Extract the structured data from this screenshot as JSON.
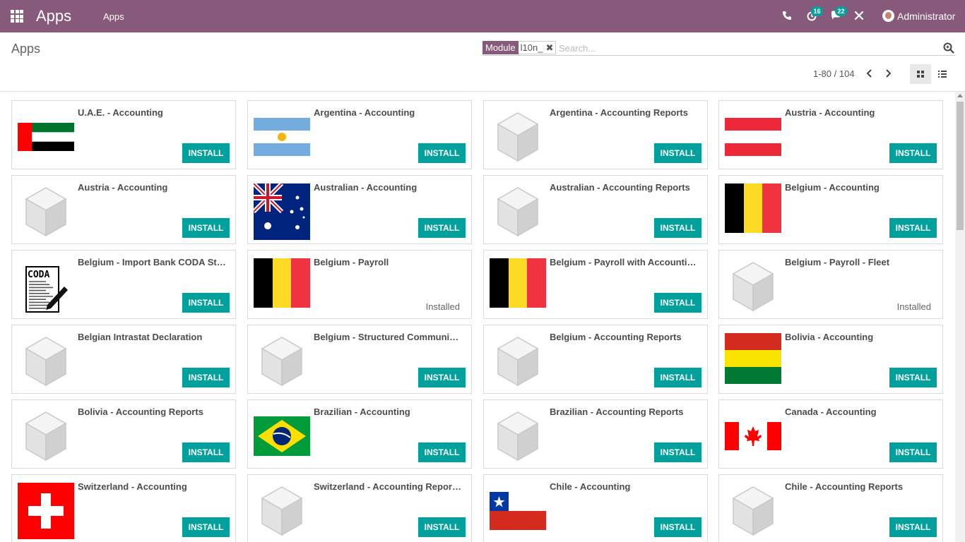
{
  "navbar": {
    "brand": "Apps",
    "menu_item": "Apps",
    "activity_count": "16",
    "messages_count": "22",
    "user_name": "Administrator",
    "bg_color": "#875a7b"
  },
  "control_panel": {
    "title": "Apps",
    "facet_category": "Module",
    "facet_value": "l10n_",
    "search_placeholder": "Search...",
    "pager_value": "1-80 / 104"
  },
  "colors": {
    "accent": "#00a09d",
    "brand": "#875a7b"
  },
  "apps": [
    {
      "name": "U.A.E. - Accounting",
      "icon": "flag-uae",
      "status": "INSTALL"
    },
    {
      "name": "Argentina - Accounting",
      "icon": "flag-argentina",
      "status": "INSTALL"
    },
    {
      "name": "Argentina - Accounting Reports",
      "icon": "default-module-cube",
      "status": "INSTALL"
    },
    {
      "name": "Austria - Accounting",
      "icon": "flag-austria",
      "status": "INSTALL"
    },
    {
      "name": "Austria - Accounting",
      "icon": "default-module-cube",
      "status": "INSTALL"
    },
    {
      "name": "Australian - Accounting",
      "icon": "flag-australia",
      "status": "INSTALL"
    },
    {
      "name": "Australian - Accounting Reports",
      "icon": "default-module-cube",
      "status": "INSTALL"
    },
    {
      "name": "Belgium - Accounting",
      "icon": "flag-belgium",
      "status": "INSTALL"
    },
    {
      "name": "Belgium - Import Bank CODA St…",
      "icon": "coda-document",
      "status": "INSTALL"
    },
    {
      "name": "Belgium - Payroll",
      "icon": "flag-belgium",
      "status": "Installed"
    },
    {
      "name": "Belgium - Payroll with Accounti…",
      "icon": "flag-belgium",
      "status": "INSTALL"
    },
    {
      "name": "Belgium - Payroll - Fleet",
      "icon": "default-module-cube",
      "status": "Installed"
    },
    {
      "name": "Belgian Intrastat Declaration",
      "icon": "default-module-cube",
      "status": "INSTALL"
    },
    {
      "name": "Belgium - Structured Communi…",
      "icon": "default-module-cube",
      "status": "INSTALL"
    },
    {
      "name": "Belgium - Accounting Reports",
      "icon": "default-module-cube",
      "status": "INSTALL"
    },
    {
      "name": "Bolivia - Accounting",
      "icon": "flag-bolivia",
      "status": "INSTALL"
    },
    {
      "name": "Bolivia - Accounting Reports",
      "icon": "default-module-cube",
      "status": "INSTALL"
    },
    {
      "name": "Brazilian - Accounting",
      "icon": "flag-brazil",
      "status": "INSTALL"
    },
    {
      "name": "Brazilian - Accounting Reports",
      "icon": "default-module-cube",
      "status": "INSTALL"
    },
    {
      "name": "Canada - Accounting",
      "icon": "flag-canada",
      "status": "INSTALL"
    },
    {
      "name": "Switzerland - Accounting",
      "icon": "flag-switzerland",
      "status": "INSTALL"
    },
    {
      "name": "Switzerland - Accounting Repor…",
      "icon": "default-module-cube",
      "status": "INSTALL"
    },
    {
      "name": "Chile - Accounting",
      "icon": "flag-chile",
      "status": "INSTALL"
    },
    {
      "name": "Chile - Accounting Reports",
      "icon": "default-module-cube",
      "status": "INSTALL"
    }
  ]
}
